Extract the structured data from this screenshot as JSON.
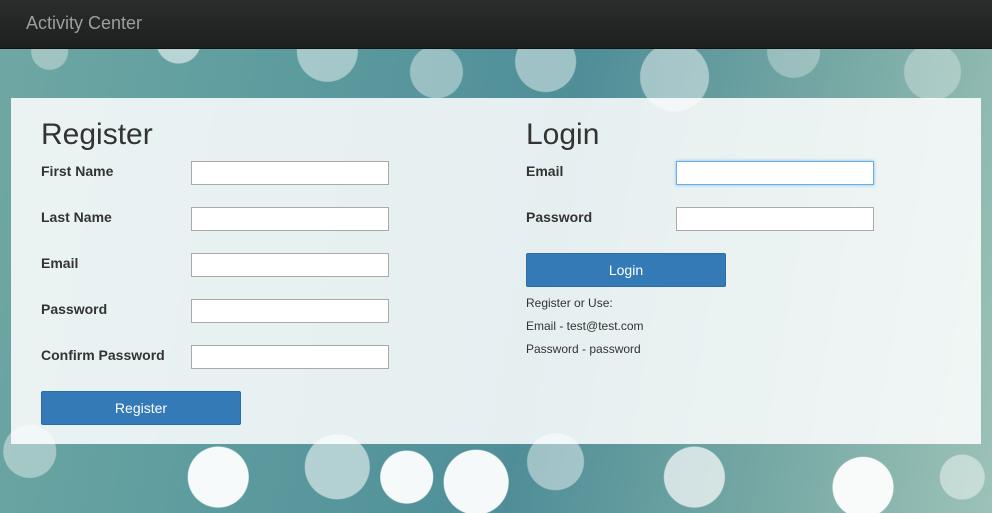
{
  "navbar": {
    "brand": "Activity Center"
  },
  "register": {
    "title": "Register",
    "fields": [
      {
        "label": "First Name",
        "value": ""
      },
      {
        "label": "Last Name",
        "value": ""
      },
      {
        "label": "Email",
        "value": ""
      },
      {
        "label": "Password",
        "value": ""
      },
      {
        "label": "Confirm Password",
        "value": ""
      }
    ],
    "button_label": "Register"
  },
  "login": {
    "title": "Login",
    "fields": [
      {
        "label": "Email",
        "value": ""
      },
      {
        "label": "Password",
        "value": ""
      }
    ],
    "button_label": "Login",
    "notes": [
      "Register or Use:",
      "Email - test@test.com",
      "Password - password"
    ]
  },
  "colors": {
    "navbar_bg": "#222222",
    "primary_button": "#337ab7",
    "focus_border": "#66afe9"
  }
}
